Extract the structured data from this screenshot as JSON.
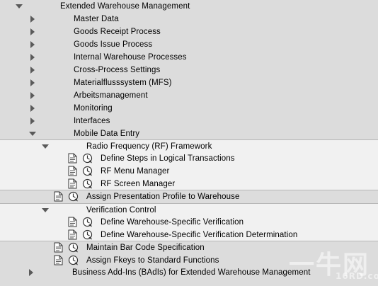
{
  "tree": {
    "root": {
      "label": "Extended Warehouse Management",
      "expanded": true
    },
    "level1": [
      {
        "label": "Master Data"
      },
      {
        "label": "Goods Receipt Process"
      },
      {
        "label": "Goods Issue Process"
      },
      {
        "label": "Internal Warehouse Processes"
      },
      {
        "label": "Cross-Process Settings"
      },
      {
        "label": "Materialflusssystem (MFS)"
      },
      {
        "label": "Arbeitsmanagement"
      },
      {
        "label": "Monitoring"
      },
      {
        "label": "Interfaces"
      }
    ],
    "mobile": {
      "label": "Mobile Data Entry",
      "expanded": true
    },
    "rf": {
      "label": "Radio Frequency (RF) Framework",
      "expanded": true
    },
    "rf_items": [
      {
        "label": "Define Steps in Logical Transactions"
      },
      {
        "label": "RF Menu Manager"
      },
      {
        "label": "RF Screen Manager"
      }
    ],
    "presentation": {
      "label": "Assign Presentation Profile to Warehouse"
    },
    "verification": {
      "label": "Verification Control",
      "expanded": true
    },
    "verification_items": [
      {
        "label": "Define Warehouse-Specific Verification"
      },
      {
        "label": "Define Warehouse-Specific Verification Determination"
      }
    ],
    "barcode": {
      "label": "Maintain Bar Code Specification"
    },
    "fkeys": {
      "label": "Assign Fkeys to Standard Functions"
    },
    "badi": {
      "label": "Business Add-Ins (BAdIs) for Extended Warehouse Management"
    }
  },
  "watermark": {
    "main": "一牛网",
    "sub": "16RD.com"
  },
  "colors": {
    "band_dark": "#dcdcdc",
    "band_light": "#f1f1f1",
    "node_triangle": "#5a5a5a"
  },
  "icons": {
    "collapsed": "triangle-right-icon",
    "expanded": "triangle-down-icon",
    "activity_doc": "document-icon",
    "activity_exec": "clock-execute-icon"
  }
}
